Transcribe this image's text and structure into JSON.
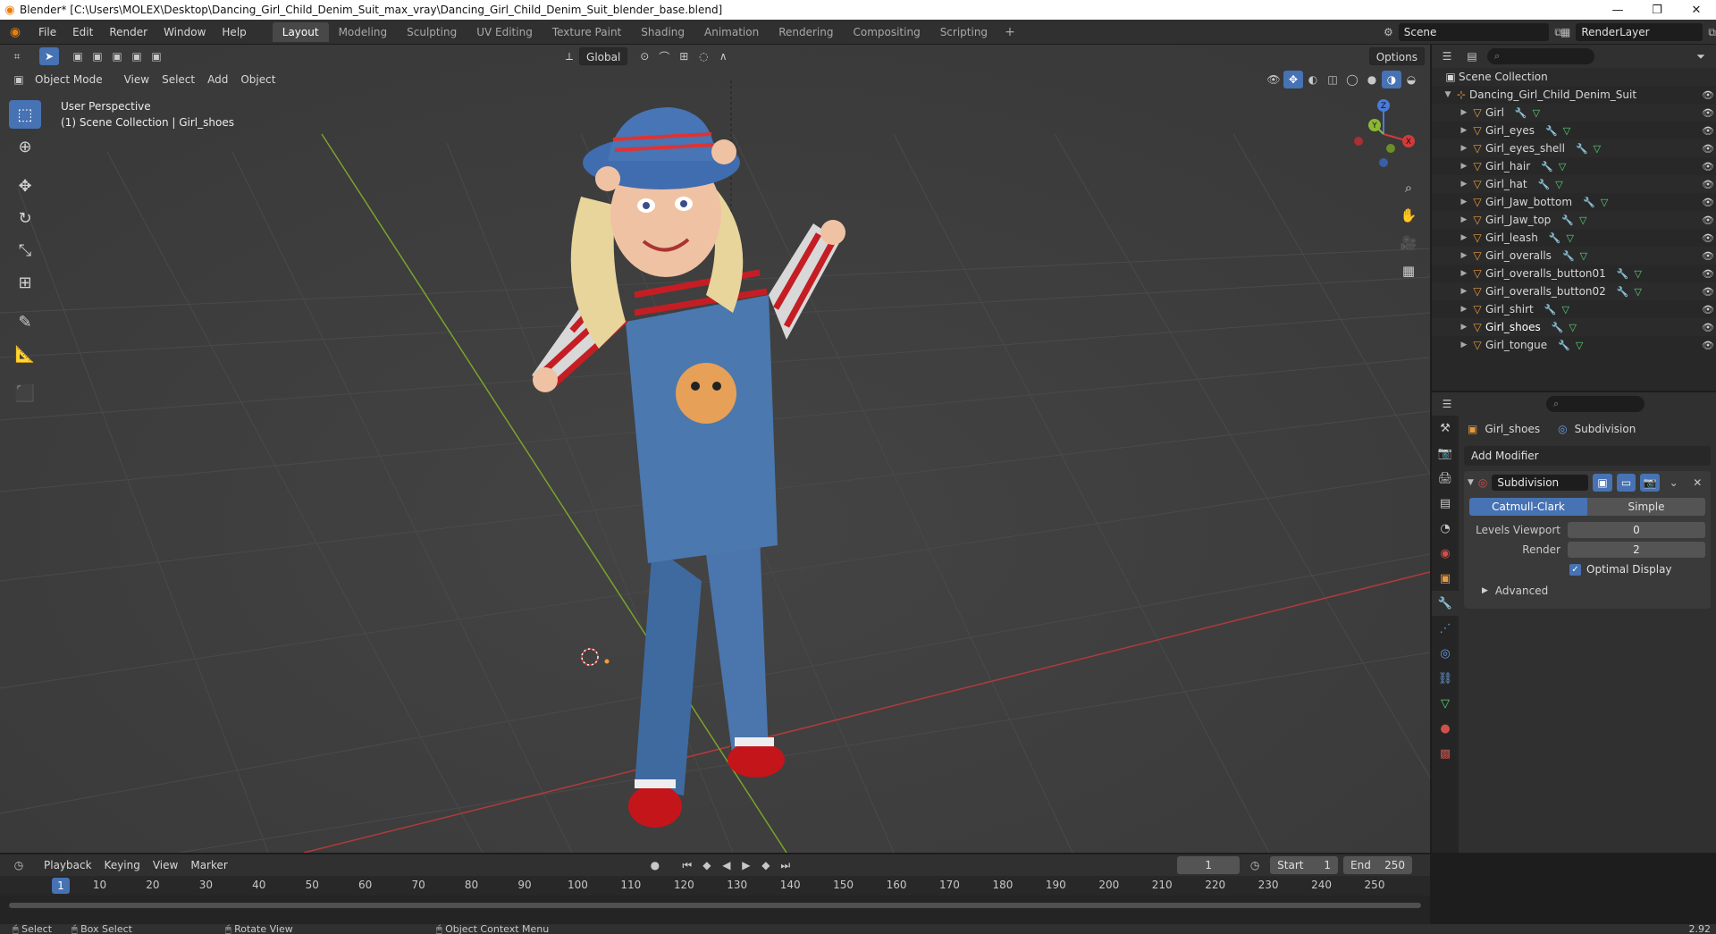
{
  "window": {
    "title": "Blender* [C:\\Users\\MOLEX\\Desktop\\Dancing_Girl_Child_Denim_Suit_max_vray\\Dancing_Girl_Child_Denim_Suit_blender_base.blend]",
    "minimize": "—",
    "maximize": "❐",
    "close": "✕"
  },
  "menu": [
    "File",
    "Edit",
    "Render",
    "Window",
    "Help"
  ],
  "workspaces": [
    "Layout",
    "Modeling",
    "Sculpting",
    "UV Editing",
    "Texture Paint",
    "Shading",
    "Animation",
    "Rendering",
    "Compositing",
    "Scripting"
  ],
  "workspace_add": "+",
  "scene": {
    "name": "Scene",
    "render_layer": "RenderLayer"
  },
  "viewport": {
    "mode": "Object Mode",
    "menus": [
      "View",
      "Select",
      "Add",
      "Object"
    ],
    "transform_orientation": "Global",
    "options": "Options",
    "overlay_line1": "User Perspective",
    "overlay_line2": "(1) Scene Collection | Girl_shoes",
    "gizmo": {
      "z": "Z",
      "y": "Y",
      "x": "X"
    }
  },
  "outliner": {
    "root": "Scene Collection",
    "collection": "Dancing_Girl_Child_Denim_Suit",
    "objects": [
      "Girl",
      "Girl_eyes",
      "Girl_eyes_shell",
      "Girl_hair",
      "Girl_hat",
      "Girl_Jaw_bottom",
      "Girl_Jaw_top",
      "Girl_leash",
      "Girl_overalls",
      "Girl_overalls_button01",
      "Girl_overalls_button02",
      "Girl_shirt",
      "Girl_shoes",
      "Girl_tongue"
    ],
    "selected": "Girl_shoes"
  },
  "properties": {
    "object": "Girl_shoes",
    "modifier_context": "Subdivision",
    "add_modifier": "Add Modifier",
    "modifier": {
      "name": "Subdivision",
      "methods": [
        "Catmull-Clark",
        "Simple"
      ],
      "levels_viewport_label": "Levels Viewport",
      "levels_viewport": "0",
      "render_label": "Render",
      "render": "2",
      "optimal_display": "Optimal Display",
      "advanced": "Advanced"
    }
  },
  "timeline": {
    "menus": [
      "Playback",
      "Keying",
      "View",
      "Marker"
    ],
    "current_frame": "1",
    "start_label": "Start",
    "start": "1",
    "end_label": "End",
    "end": "250",
    "ticks": [
      "1",
      "10",
      "20",
      "30",
      "40",
      "50",
      "60",
      "70",
      "80",
      "90",
      "100",
      "110",
      "120",
      "130",
      "140",
      "150",
      "160",
      "170",
      "180",
      "190",
      "200",
      "210",
      "220",
      "230",
      "240",
      "250"
    ]
  },
  "status": {
    "select": "Select",
    "box_select": "Box Select",
    "rotate_view": "Rotate View",
    "context_menu": "Object Context Menu",
    "version": "2.92"
  },
  "colors": {
    "accent": "#4772b3",
    "object": "#e89a3c",
    "mesh": "#5bd37a",
    "modifier": "#6a9ce0",
    "grid_x": "#b33a3a",
    "grid_y": "#7aa32a"
  }
}
